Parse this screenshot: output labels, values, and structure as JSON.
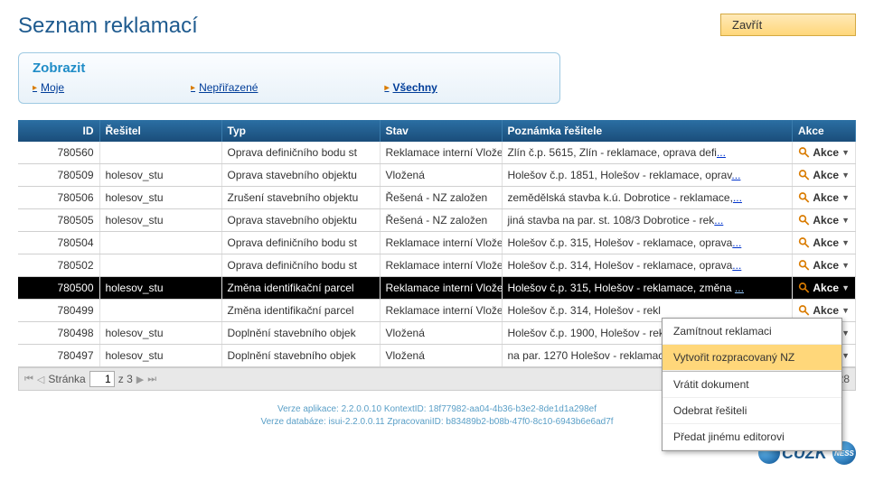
{
  "page_title": "Seznam reklamací",
  "close_button": "Zavřít",
  "filter": {
    "title": "Zobrazit",
    "links": [
      "Moje",
      "Nepřiřazené",
      "Všechny"
    ],
    "active": 2
  },
  "columns": {
    "id": "ID",
    "resitel": "Řešitel",
    "typ": "Typ",
    "stav": "Stav",
    "poznamka": "Poznámka řešitele",
    "akce": "Akce"
  },
  "akce_label": "Akce",
  "rows": [
    {
      "id": "780560",
      "resitel": "",
      "typ": "Oprava definičního bodu st",
      "stav": "Reklamace interní Vložená",
      "poznamka": "Zlín č.p. 5615, Zlín - reklamace, oprava defi",
      "more": "..."
    },
    {
      "id": "780509",
      "resitel": "holesov_stu",
      "typ": "Oprava stavebního objektu",
      "stav": "Vložená",
      "poznamka": "Holešov č.p. 1851, Holešov - reklamace, oprav",
      "more": "..."
    },
    {
      "id": "780506",
      "resitel": "holesov_stu",
      "typ": "Zrušení stavebního objektu",
      "stav": "Řešená - NZ založen",
      "poznamka": "zemědělská stavba k.ú. Dobrotice - reklamace,",
      "more": "..."
    },
    {
      "id": "780505",
      "resitel": "holesov_stu",
      "typ": "Oprava stavebního objektu",
      "stav": "Řešená - NZ založen",
      "poznamka": "jiná stavba na par. st. 108/3 Dobrotice - rek",
      "more": "..."
    },
    {
      "id": "780504",
      "resitel": "",
      "typ": "Oprava definičního bodu st",
      "stav": "Reklamace interní Vložená",
      "poznamka": "Holešov č.p. 315, Holešov - reklamace, oprava",
      "more": "..."
    },
    {
      "id": "780502",
      "resitel": "",
      "typ": "Oprava definičního bodu st",
      "stav": "Reklamace interní Vložená",
      "poznamka": "Holešov č.p. 314, Holešov - reklamace, oprava",
      "more": "..."
    },
    {
      "id": "780500",
      "resitel": "holesov_stu",
      "typ": "Změna identifikační parcel",
      "stav": "Reklamace interní Vložená",
      "poznamka": "Holešov č.p. 315, Holešov - reklamace, změna ",
      "more": "...",
      "selected": true
    },
    {
      "id": "780499",
      "resitel": "",
      "typ": "Změna identifikační parcel",
      "stav": "Reklamace interní Vložená",
      "poznamka": "Holešov č.p. 314, Holešov - rekl",
      "more": ""
    },
    {
      "id": "780498",
      "resitel": "holesov_stu",
      "typ": "Doplnění stavebního objek",
      "stav": "Vložená",
      "poznamka": "Holešov č.p. 1900, Holešov - rek",
      "more": ""
    },
    {
      "id": "780497",
      "resitel": "holesov_stu",
      "typ": "Doplnění stavebního objek",
      "stav": "Vložená",
      "poznamka": "na par. 1270 Holešov - reklamac",
      "more": ""
    }
  ],
  "pager": {
    "label": "Stránka",
    "page": "1",
    "total": "z 3",
    "summary": "28"
  },
  "dropdown": {
    "items": [
      "Zamítnout reklamaci",
      "Vytvořit rozpracovaný NZ",
      "Vrátit dokument",
      "Odebrat řešiteli",
      "Předat jinému editorovi"
    ],
    "highlight": 1
  },
  "footer": {
    "line1": "Verze aplikace: 2.2.0.0.10 KontextID: 18f77982-aa04-4b36-b3e2-8de1d1a298ef",
    "line2": "Verze databáze: isui-2.2.0.0.11 ZpracovaniID: b83489b2-b08b-47f0-8c10-6943b6e6ad7f"
  },
  "logo_text": "ČÚZK"
}
